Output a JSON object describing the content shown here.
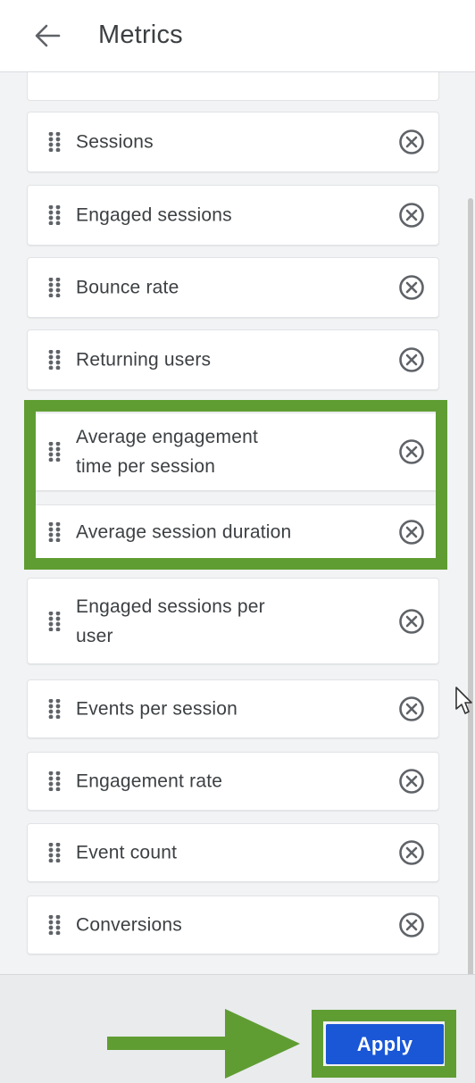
{
  "header": {
    "title": "Metrics",
    "back_icon": "arrow-left-icon"
  },
  "metrics": [
    {
      "label": "Sessions",
      "lines": [
        "Sessions"
      ],
      "highlighted": false
    },
    {
      "label": "Engaged sessions",
      "lines": [
        "Engaged sessions"
      ],
      "highlighted": false
    },
    {
      "label": "Bounce rate",
      "lines": [
        "Bounce rate"
      ],
      "highlighted": false
    },
    {
      "label": "Returning users",
      "lines": [
        "Returning users"
      ],
      "highlighted": false
    },
    {
      "label": "Average engagement time per session",
      "lines": [
        "Average engagement",
        "time per session"
      ],
      "highlighted": true
    },
    {
      "label": "Average session duration",
      "lines": [
        "Average session duration"
      ],
      "highlighted": true
    },
    {
      "label": "Engaged sessions per user",
      "lines": [
        "Engaged sessions per",
        "user"
      ],
      "highlighted": false
    },
    {
      "label": "Events per session",
      "lines": [
        "Events per session"
      ],
      "highlighted": false
    },
    {
      "label": "Engagement rate",
      "lines": [
        "Engagement rate"
      ],
      "highlighted": false
    },
    {
      "label": "Event count",
      "lines": [
        "Event count"
      ],
      "highlighted": false
    },
    {
      "label": "Conversions",
      "lines": [
        "Conversions"
      ],
      "highlighted": false
    }
  ],
  "footer": {
    "apply_label": "Apply"
  },
  "colors": {
    "highlight": "#5f9d33",
    "apply_button": "#1a57d6",
    "icon": "#5f6368"
  }
}
